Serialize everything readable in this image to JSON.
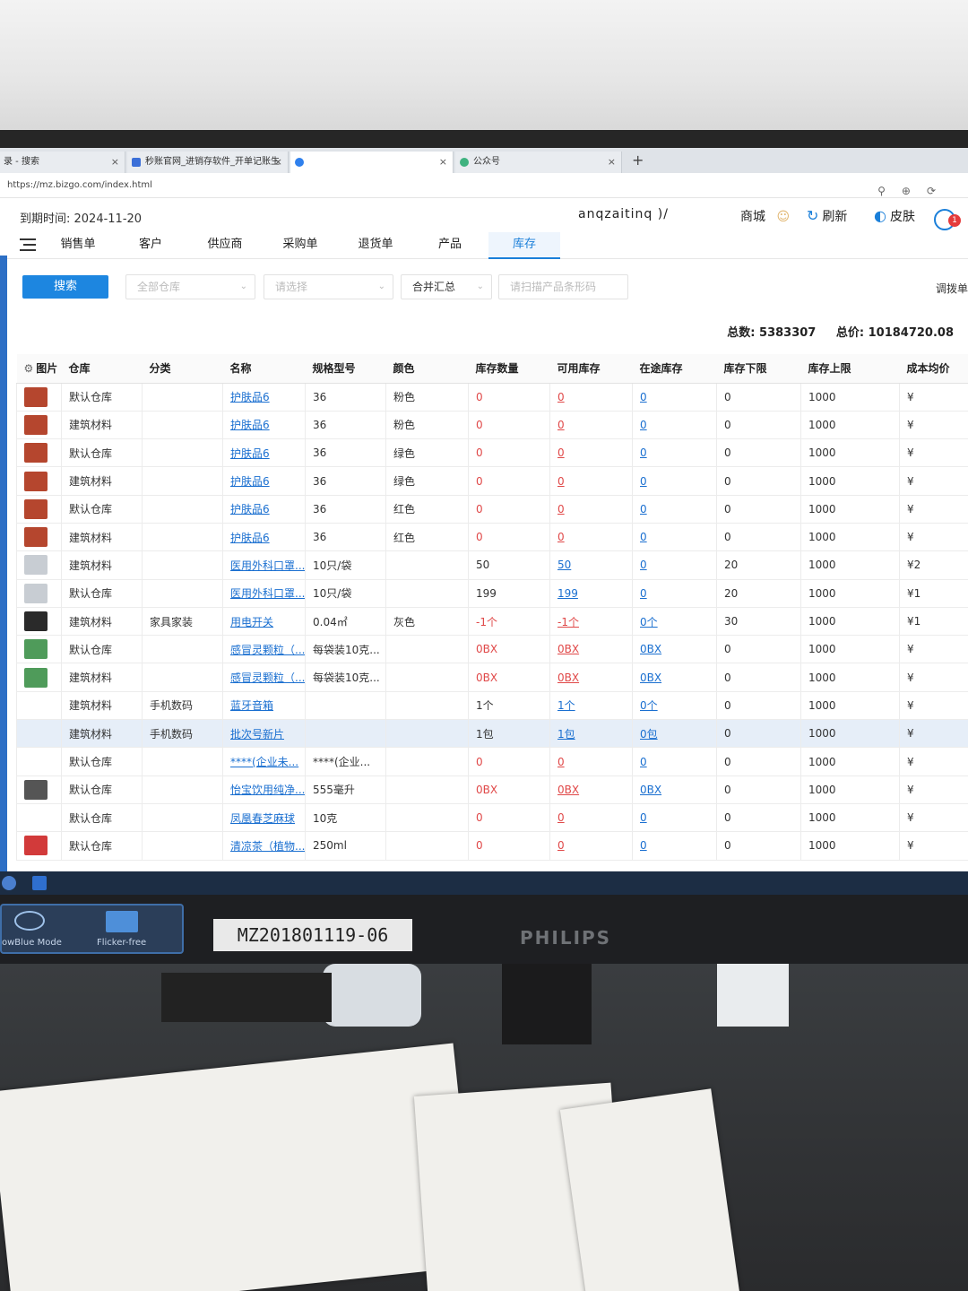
{
  "browser": {
    "tabs": [
      {
        "title": "录 - 搜索",
        "color": "#5b8dd6"
      },
      {
        "title": "秒账官网_进销存软件_开单记账生",
        "color": "#3b6fd8"
      },
      {
        "title": "",
        "color": "#2f80ed"
      },
      {
        "title": "公众号",
        "color": "#3fb27f"
      }
    ],
    "new_tab_label": "+",
    "url": "https://mz.bizgo.com/index.html"
  },
  "header": {
    "expire_label": "到期时间: 2024-11-20",
    "username": "anqzaitinq )/",
    "mall_label": "商城",
    "refresh_label": "刷新",
    "skin_label": "皮肤",
    "notify_count": "1"
  },
  "nav": {
    "items": [
      "销售单",
      "客户",
      "供应商",
      "采购单",
      "退货单",
      "产品",
      "库存"
    ],
    "active": "库存"
  },
  "filters": {
    "search_button": "搜索",
    "warehouse_placeholder": "全部仓库",
    "select_placeholder": "请选择",
    "merge_option": "合并汇总",
    "barcode_placeholder": "请扫描产品条形码",
    "transfer_button": "调拨单"
  },
  "totals": {
    "count_label": "总数: 5383307",
    "price_label": "总价: 10184720.08"
  },
  "table": {
    "headers": [
      "图片",
      "仓库",
      "分类",
      "名称",
      "规格型号",
      "颜色",
      "库存数量",
      "可用库存",
      "在途库存",
      "库存下限",
      "库存上限",
      "成本均价"
    ],
    "rows": [
      {
        "thumb": "#b5462e",
        "warehouse": "默认仓库",
        "category": "",
        "name": "护肤品6",
        "spec": "36",
        "color": "粉色",
        "qty": "0",
        "avail": "0",
        "transit": "0",
        "min": "0",
        "max": "1000",
        "cost": "¥"
      },
      {
        "thumb": "#b5462e",
        "warehouse": "建筑材料",
        "category": "",
        "name": "护肤品6",
        "spec": "36",
        "color": "粉色",
        "qty": "0",
        "avail": "0",
        "transit": "0",
        "min": "0",
        "max": "1000",
        "cost": "¥"
      },
      {
        "thumb": "#b5462e",
        "warehouse": "默认仓库",
        "category": "",
        "name": "护肤品6",
        "spec": "36",
        "color": "绿色",
        "qty": "0",
        "avail": "0",
        "transit": "0",
        "min": "0",
        "max": "1000",
        "cost": "¥"
      },
      {
        "thumb": "#b5462e",
        "warehouse": "建筑材料",
        "category": "",
        "name": "护肤品6",
        "spec": "36",
        "color": "绿色",
        "qty": "0",
        "avail": "0",
        "transit": "0",
        "min": "0",
        "max": "1000",
        "cost": "¥"
      },
      {
        "thumb": "#b5462e",
        "warehouse": "默认仓库",
        "category": "",
        "name": "护肤品6",
        "spec": "36",
        "color": "红色",
        "qty": "0",
        "avail": "0",
        "transit": "0",
        "min": "0",
        "max": "1000",
        "cost": "¥"
      },
      {
        "thumb": "#b5462e",
        "warehouse": "建筑材料",
        "category": "",
        "name": "护肤品6",
        "spec": "36",
        "color": "红色",
        "qty": "0",
        "avail": "0",
        "transit": "0",
        "min": "0",
        "max": "1000",
        "cost": "¥"
      },
      {
        "thumb": "#c8cdd3",
        "warehouse": "建筑材料",
        "category": "",
        "name": "医用外科口罩...",
        "spec": "10只/袋",
        "color": "",
        "qty": "50",
        "avail": "50",
        "transit": "0",
        "min": "20",
        "max": "1000",
        "cost": "¥2"
      },
      {
        "thumb": "#c8cdd3",
        "warehouse": "默认仓库",
        "category": "",
        "name": "医用外科口罩...",
        "spec": "10只/袋",
        "color": "",
        "qty": "199",
        "avail": "199",
        "transit": "0",
        "min": "20",
        "max": "1000",
        "cost": "¥1"
      },
      {
        "thumb": "#2a2a2a",
        "warehouse": "建筑材料",
        "category": "家具家装",
        "name": "用电开关",
        "spec": "0.04㎡",
        "color": "灰色",
        "qty": "-1个",
        "avail": "-1个",
        "transit": "0个",
        "min": "30",
        "max": "1000",
        "cost": "¥1"
      },
      {
        "thumb": "#4f9b5a",
        "warehouse": "默认仓库",
        "category": "",
        "name": "感冒灵颗粒（...",
        "spec": "每袋装10克...",
        "color": "",
        "qty": "0BX",
        "avail": "0BX",
        "transit": "0BX",
        "min": "0",
        "max": "1000",
        "cost": "¥"
      },
      {
        "thumb": "#4f9b5a",
        "warehouse": "建筑材料",
        "category": "",
        "name": "感冒灵颗粒（...",
        "spec": "每袋装10克...",
        "color": "",
        "qty": "0BX",
        "avail": "0BX",
        "transit": "0BX",
        "min": "0",
        "max": "1000",
        "cost": "¥"
      },
      {
        "thumb": "",
        "warehouse": "建筑材料",
        "category": "手机数码",
        "name": "蓝牙音箱",
        "spec": "",
        "color": "",
        "qty": "1个",
        "avail": "1个",
        "transit": "0个",
        "min": "0",
        "max": "1000",
        "cost": "¥"
      },
      {
        "thumb": "",
        "warehouse": "建筑材料",
        "category": "手机数码",
        "name": "批次号新片",
        "spec": "",
        "color": "",
        "qty": "1包",
        "avail": "1包",
        "transit": "0包",
        "min": "0",
        "max": "1000",
        "cost": "¥"
      },
      {
        "thumb": "",
        "warehouse": "默认仓库",
        "category": "",
        "name": "****(企业未...",
        "spec": "****(企业...",
        "color": "",
        "qty": "0",
        "avail": "0",
        "transit": "0",
        "min": "0",
        "max": "1000",
        "cost": "¥"
      },
      {
        "thumb": "#555555",
        "warehouse": "默认仓库",
        "category": "",
        "name": "怡宝饮用纯净...",
        "spec": "555毫升",
        "color": "",
        "qty": "0BX",
        "avail": "0BX",
        "transit": "0BX",
        "min": "0",
        "max": "1000",
        "cost": "¥"
      },
      {
        "thumb": "",
        "warehouse": "默认仓库",
        "category": "",
        "name": "凤凰春芝麻球",
        "spec": "10克",
        "color": "",
        "qty": "0",
        "avail": "0",
        "transit": "0",
        "min": "0",
        "max": "1000",
        "cost": "¥"
      },
      {
        "thumb": "#d23a3a",
        "warehouse": "默认仓库",
        "category": "",
        "name": "清凉茶（植物...",
        "spec": "250ml",
        "color": "",
        "qty": "0",
        "avail": "0",
        "transit": "0",
        "min": "0",
        "max": "1000",
        "cost": "¥"
      }
    ]
  },
  "monitor": {
    "osd_left": "owBlue Mode",
    "osd_right": "Flicker-free",
    "model_label": "MZ201801119-06",
    "brand": "PHILIPS"
  }
}
